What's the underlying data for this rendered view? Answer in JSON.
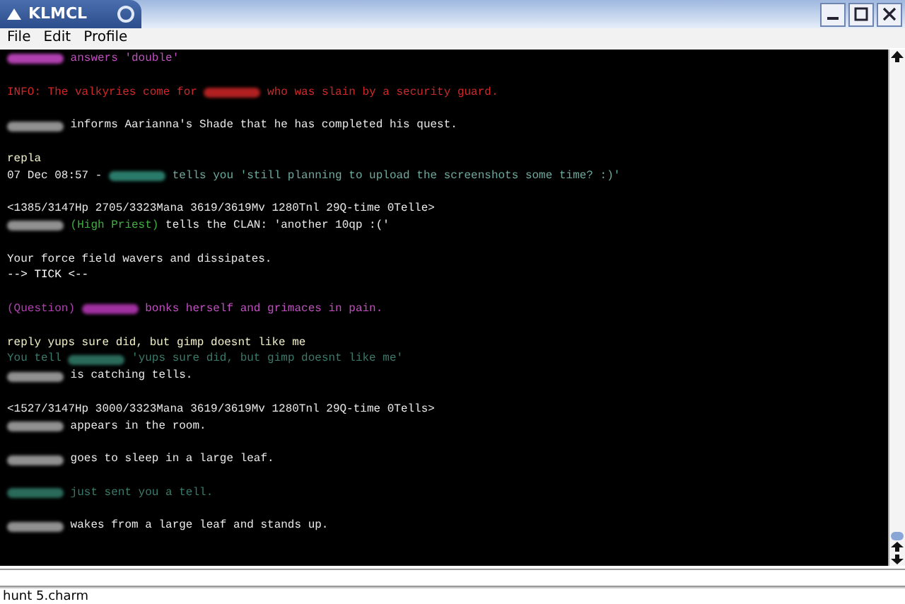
{
  "window": {
    "title": "KLMCL"
  },
  "menu": [
    {
      "label": "File"
    },
    {
      "label": "Edit"
    },
    {
      "label": "Profile"
    }
  ],
  "output": [
    {
      "kind": "text",
      "segments": [
        {
          "kind": "redacted",
          "color": "#b040b0"
        },
        {
          "kind": "text",
          "text": " answers 'double'",
          "color": "#c050c0"
        }
      ]
    },
    {
      "kind": "blank"
    },
    {
      "kind": "text",
      "segments": [
        {
          "kind": "text",
          "text": "INFO: The valkyries come for ",
          "color": "#d02828"
        },
        {
          "kind": "redacted",
          "color": "#b02020"
        },
        {
          "kind": "text",
          "text": " who was slain by a security guard.",
          "color": "#d02828"
        }
      ]
    },
    {
      "kind": "blank"
    },
    {
      "kind": "text",
      "segments": [
        {
          "kind": "redacted",
          "color": "#909090"
        },
        {
          "kind": "text",
          "text": " informs Aarianna's Shade that he has completed his quest.",
          "color": "#e8e8e8"
        }
      ]
    },
    {
      "kind": "blank"
    },
    {
      "kind": "text",
      "segments": [
        {
          "kind": "text",
          "text": "repla",
          "color": "#f0f0c8"
        }
      ]
    },
    {
      "kind": "text",
      "segments": [
        {
          "kind": "text",
          "text": "07 Dec 08:57 - ",
          "color": "#e8e8e8"
        },
        {
          "kind": "redacted",
          "color": "#2a7a6a"
        },
        {
          "kind": "text",
          "text": " tells you 'still planning to upload the screenshots some time? :)'",
          "color": "#6fa89c"
        }
      ]
    },
    {
      "kind": "blank"
    },
    {
      "kind": "text",
      "segments": [
        {
          "kind": "text",
          "text": "<1385/3147Hp 2705/3323Mana 3619/3619Mv 1280Tnl 29Q-time 0Telle>",
          "color": "#e8e8e8"
        }
      ]
    },
    {
      "kind": "text",
      "segments": [
        {
          "kind": "redacted",
          "color": "#909090"
        },
        {
          "kind": "text",
          "text": " (High Priest)",
          "color": "#40b040"
        },
        {
          "kind": "text",
          "text": " tells the CLAN: 'another 10qp :('",
          "color": "#e8e8e8"
        }
      ]
    },
    {
      "kind": "blank"
    },
    {
      "kind": "text",
      "segments": [
        {
          "kind": "text",
          "text": "Your force field wavers and dissipates.",
          "color": "#e8e8e8"
        }
      ]
    },
    {
      "kind": "text",
      "segments": [
        {
          "kind": "text",
          "text": "--> TICK <--",
          "color": "#ffffff"
        }
      ]
    },
    {
      "kind": "blank"
    },
    {
      "kind": "text",
      "segments": [
        {
          "kind": "text",
          "text": "(Question) ",
          "color": "#b040b0"
        },
        {
          "kind": "redacted",
          "color": "#a030a0"
        },
        {
          "kind": "text",
          "text": " bonks herself and grimaces in pain.",
          "color": "#c050c0"
        }
      ]
    },
    {
      "kind": "blank"
    },
    {
      "kind": "text",
      "segments": [
        {
          "kind": "text",
          "text": "reply yups sure did, but gimp doesnt like me",
          "color": "#f0f0c8"
        }
      ]
    },
    {
      "kind": "text",
      "segments": [
        {
          "kind": "text",
          "text": "You tell ",
          "color": "#3a7a6a"
        },
        {
          "kind": "redacted",
          "color": "#2a6a5a"
        },
        {
          "kind": "text",
          "text": " 'yups sure did, but gimp doesnt like me'",
          "color": "#3a7a6a"
        }
      ]
    },
    {
      "kind": "text",
      "segments": [
        {
          "kind": "redacted",
          "color": "#909090"
        },
        {
          "kind": "text",
          "text": " is catching tells.",
          "color": "#e8e8e8"
        }
      ]
    },
    {
      "kind": "blank"
    },
    {
      "kind": "text",
      "segments": [
        {
          "kind": "text",
          "text": "<1527/3147Hp 3000/3323Mana 3619/3619Mv 1280Tnl 29Q-time 0Tells>",
          "color": "#e8e8e8"
        }
      ]
    },
    {
      "kind": "text",
      "segments": [
        {
          "kind": "redacted",
          "color": "#909090"
        },
        {
          "kind": "text",
          "text": " appears in the room.",
          "color": "#e8e8e8"
        }
      ]
    },
    {
      "kind": "blank"
    },
    {
      "kind": "text",
      "segments": [
        {
          "kind": "redacted",
          "color": "#909090"
        },
        {
          "kind": "text",
          "text": " goes to sleep in a large leaf.",
          "color": "#e8e8e8"
        }
      ]
    },
    {
      "kind": "blank"
    },
    {
      "kind": "text",
      "segments": [
        {
          "kind": "redacted",
          "color": "#2a6a5a"
        },
        {
          "kind": "text",
          "text": " just sent you a tell.",
          "color": "#3a7a6a"
        }
      ]
    },
    {
      "kind": "blank"
    },
    {
      "kind": "text",
      "segments": [
        {
          "kind": "redacted",
          "color": "#909090"
        },
        {
          "kind": "text",
          "text": " wakes from a large leaf and stands up.",
          "color": "#e8e8e8"
        }
      ]
    }
  ],
  "status_bar": {
    "text": "hunt 5.charm"
  }
}
